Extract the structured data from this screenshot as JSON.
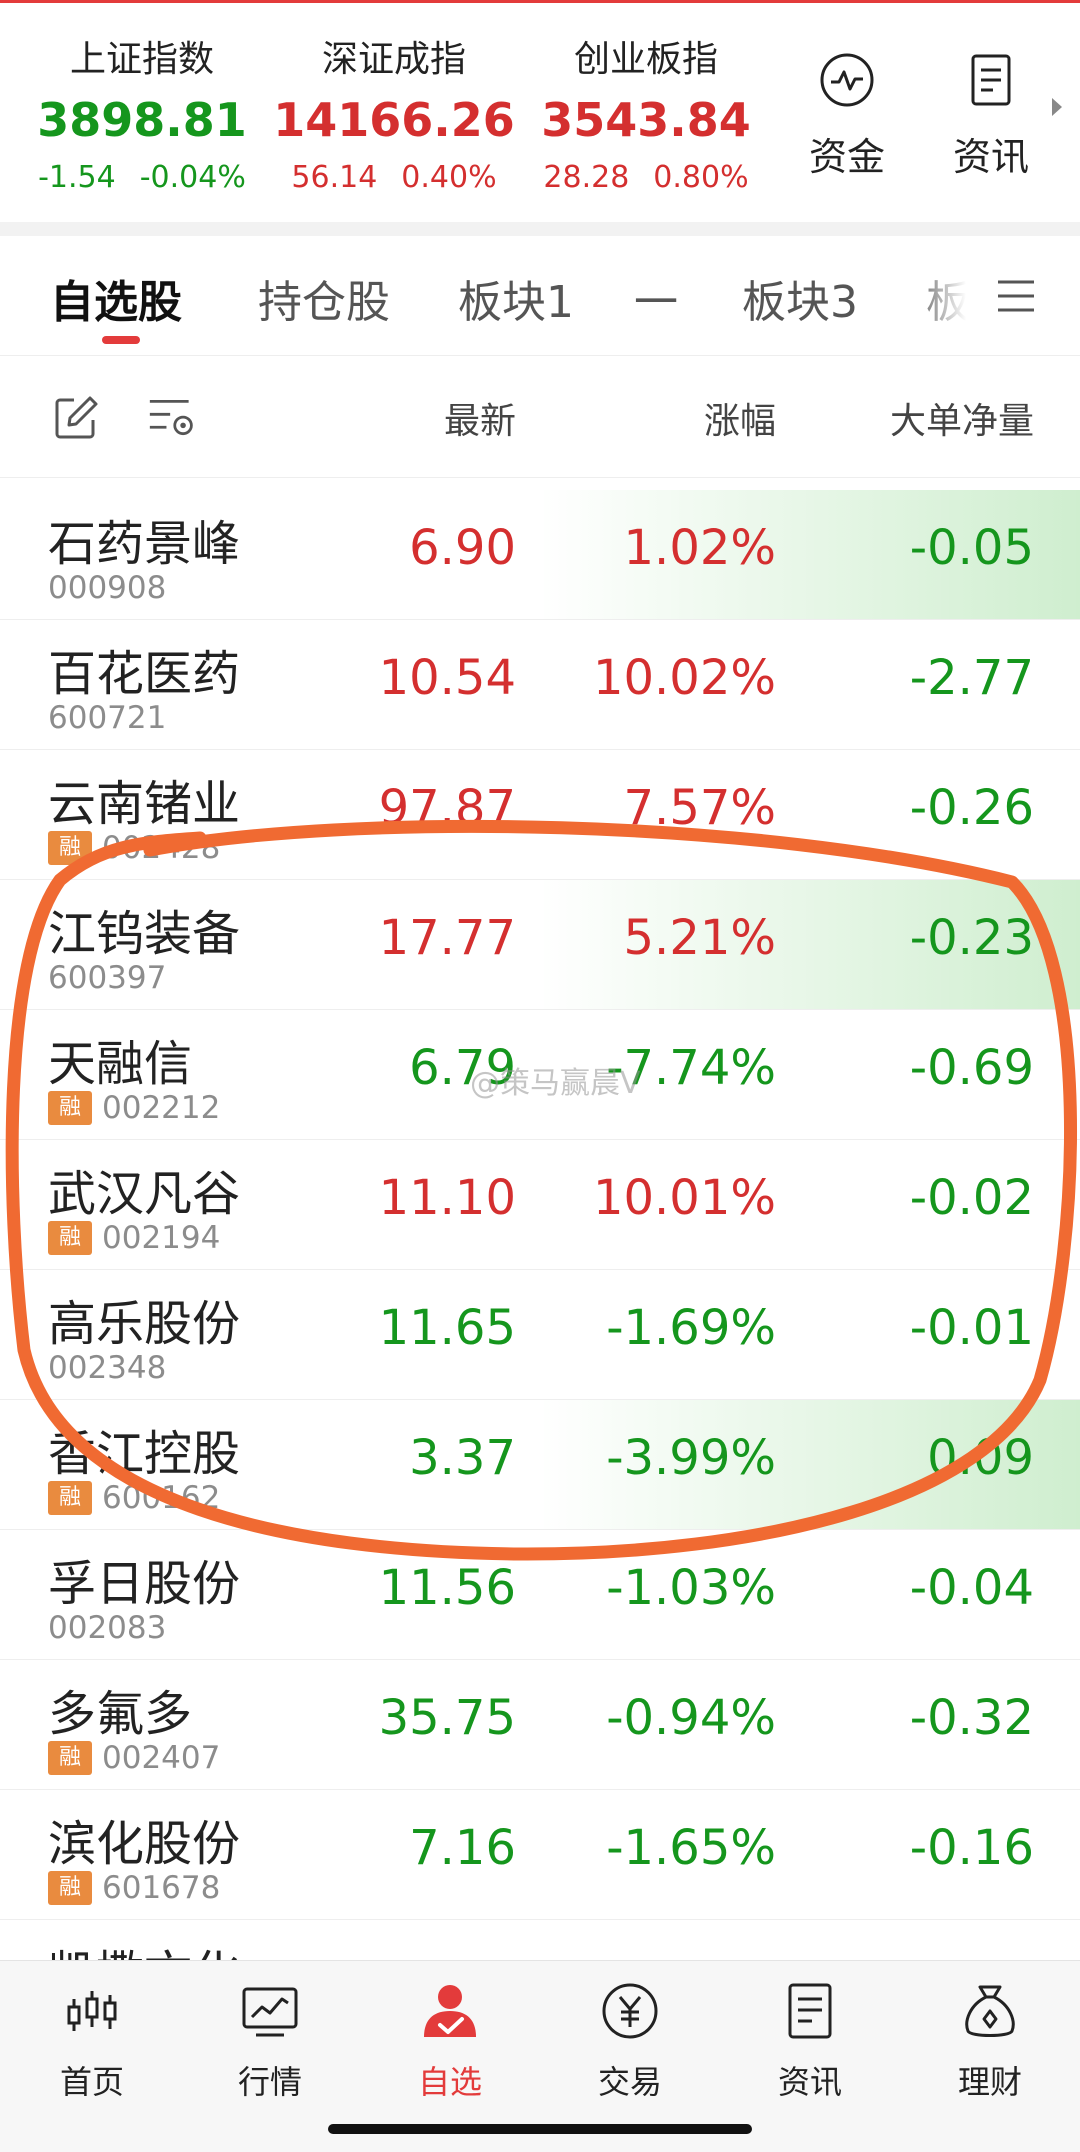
{
  "indices": [
    {
      "name": "上证指数",
      "value": "3898.81",
      "change": "-1.54",
      "percent": "-0.04%",
      "trend": "down"
    },
    {
      "name": "深证成指",
      "value": "14166.26",
      "change": "56.14",
      "percent": "0.40%",
      "trend": "up"
    },
    {
      "name": "创业板指",
      "value": "3543.84",
      "change": "28.28",
      "percent": "0.80%",
      "trend": "up"
    }
  ],
  "quick_links": [
    {
      "label": "资金",
      "icon": "pulse-icon"
    },
    {
      "label": "资讯",
      "icon": "document-icon"
    }
  ],
  "tabs": [
    "自选股",
    "持仓股",
    "板块1",
    "一",
    "板块3",
    "板"
  ],
  "active_tab": "自选股",
  "columns": {
    "price": "最新",
    "change": "涨幅",
    "net_volume": "大单净量"
  },
  "stocks": [
    {
      "name": "石药景峰",
      "code": "000908",
      "margin": false,
      "price": "6.90",
      "change": "1.02%",
      "net": "-0.05",
      "trend": "up",
      "highlight": true
    },
    {
      "name": "百花医药",
      "code": "600721",
      "margin": false,
      "price": "10.54",
      "change": "10.02%",
      "net": "-2.77",
      "trend": "up",
      "highlight": false
    },
    {
      "name": "云南锗业",
      "code": "002428",
      "margin": true,
      "price": "97.87",
      "change": "7.57%",
      "net": "-0.26",
      "trend": "up",
      "highlight": false
    },
    {
      "name": "江钨装备",
      "code": "600397",
      "margin": false,
      "price": "17.77",
      "change": "5.21%",
      "net": "-0.23",
      "trend": "up",
      "highlight": true
    },
    {
      "name": "天融信",
      "code": "002212",
      "margin": true,
      "price": "6.79",
      "change": "-7.74%",
      "net": "-0.69",
      "trend": "down",
      "highlight": false
    },
    {
      "name": "武汉凡谷",
      "code": "002194",
      "margin": true,
      "price": "11.10",
      "change": "10.01%",
      "net": "-0.02",
      "trend": "up",
      "highlight": false
    },
    {
      "name": "高乐股份",
      "code": "002348",
      "margin": false,
      "price": "11.65",
      "change": "-1.69%",
      "net": "-0.01",
      "trend": "down",
      "highlight": false
    },
    {
      "name": "香江控股",
      "code": "600162",
      "margin": true,
      "price": "3.37",
      "change": "-3.99%",
      "net": "0.09",
      "trend": "down",
      "highlight": true
    },
    {
      "name": "孚日股份",
      "code": "002083",
      "margin": false,
      "price": "11.56",
      "change": "-1.03%",
      "net": "-0.04",
      "trend": "down",
      "highlight": false
    },
    {
      "name": "多氟多",
      "code": "002407",
      "margin": true,
      "price": "35.75",
      "change": "-0.94%",
      "net": "-0.32",
      "trend": "down",
      "highlight": false
    },
    {
      "name": "滨化股份",
      "code": "601678",
      "margin": true,
      "price": "7.16",
      "change": "-1.65%",
      "net": "-0.16",
      "trend": "down",
      "highlight": false
    },
    {
      "name": "凯撒文化",
      "code": "",
      "margin": false,
      "price": "",
      "change": "",
      "net": "",
      "trend": "down",
      "highlight": false
    }
  ],
  "margin_badge": "融",
  "watermark": "@策马赢晨V",
  "nav": [
    {
      "label": "首页",
      "icon": "candlestick-icon",
      "active": false
    },
    {
      "label": "行情",
      "icon": "chart-icon",
      "active": false
    },
    {
      "label": "自选",
      "icon": "user-check-icon",
      "active": true
    },
    {
      "label": "交易",
      "icon": "yen-icon",
      "active": false
    },
    {
      "label": "资讯",
      "icon": "document-icon",
      "active": false
    },
    {
      "label": "理财",
      "icon": "money-bag-icon",
      "active": false
    }
  ],
  "colors": {
    "up": "#d42f2f",
    "down": "#15961d",
    "accent": "#e33b3b",
    "annotation": "#f06a32",
    "margin_badge": "#e98b3f"
  }
}
